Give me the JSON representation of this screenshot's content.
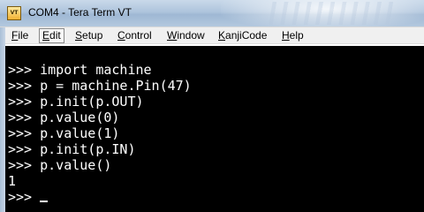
{
  "window": {
    "title": "COM4 - Tera Term VT",
    "icon_label": "VT",
    "icon": "teraterm-app-icon"
  },
  "menu": {
    "items": [
      {
        "label": "File",
        "mnemonic": "F",
        "rest": "ile"
      },
      {
        "label": "Edit",
        "mnemonic": "E",
        "rest": "dit"
      },
      {
        "label": "Setup",
        "mnemonic": "S",
        "rest": "etup"
      },
      {
        "label": "Control",
        "mnemonic": "C",
        "rest": "ontrol"
      },
      {
        "label": "Window",
        "mnemonic": "W",
        "rest": "indow"
      },
      {
        "label": "KanjiCode",
        "mnemonic": "K",
        "rest": "anjiCode"
      },
      {
        "label": "Help",
        "mnemonic": "H",
        "rest": "elp"
      }
    ],
    "active_item": "Edit"
  },
  "terminal": {
    "background": "#000000",
    "foreground": "#ffffff",
    "lines": [
      ">>> import machine",
      ">>> p = machine.Pin(47)",
      ">>> p.init(p.OUT)",
      ">>> p.value(0)",
      ">>> p.value(1)",
      ">>> p.init(p.IN)",
      ">>> p.value()",
      "1",
      ">>> "
    ]
  }
}
